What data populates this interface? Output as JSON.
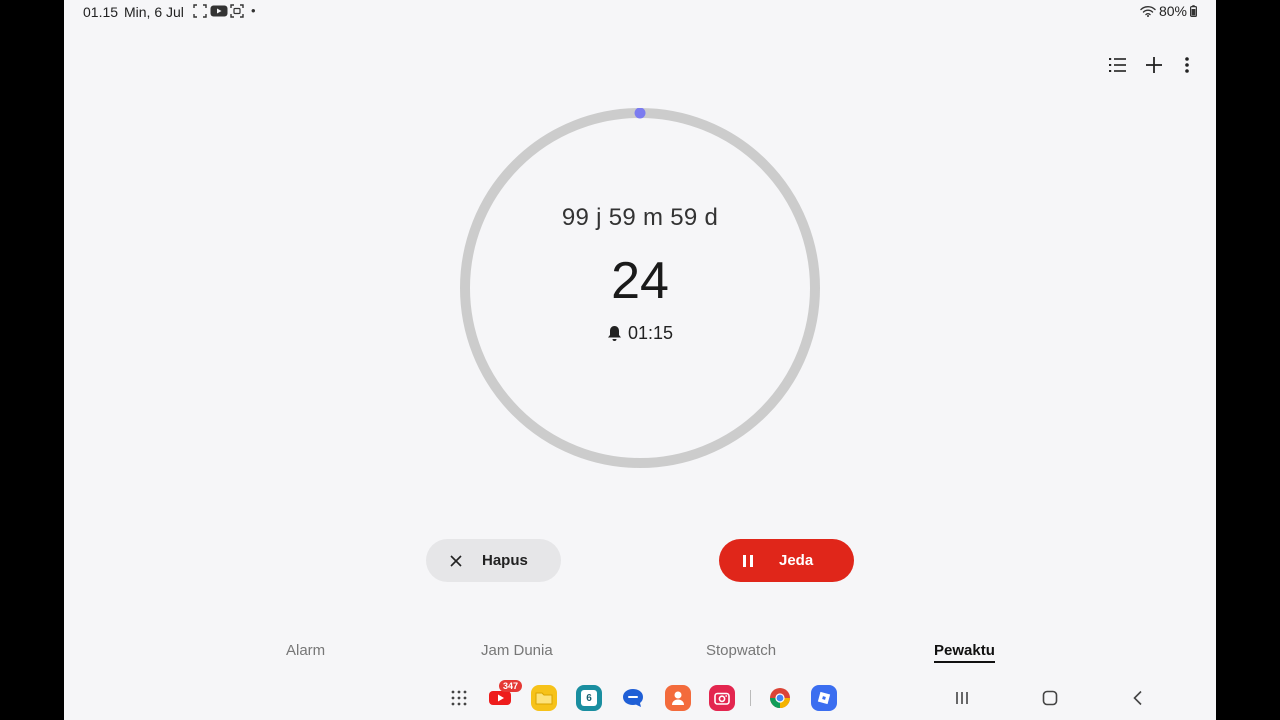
{
  "status_bar": {
    "time": "01.15",
    "date": "Min, 6 Jul",
    "dot": "•",
    "battery": "80%",
    "icons": [
      "screenshot-icon",
      "youtube-icon",
      "screen-record-icon",
      "wifi-icon",
      "battery-icon"
    ]
  },
  "toolbar": {
    "icons": [
      "list-icon",
      "plus-icon",
      "more-vert-icon"
    ]
  },
  "timer": {
    "remaining": "99 j 59 m 59 d",
    "preset": "24",
    "alarm_time": "01:15",
    "accent_color": "#7b7bf0",
    "ring_color": "#cccccc"
  },
  "actions": {
    "delete_label": "Hapus",
    "pause_label": "Jeda",
    "pause_color": "#e0261a"
  },
  "tabs": [
    {
      "label": "Alarm",
      "active": false
    },
    {
      "label": "Jam Dunia",
      "active": false
    },
    {
      "label": "Stopwatch",
      "active": false
    },
    {
      "label": "Pewaktu",
      "active": true
    }
  ],
  "dock": {
    "apps": [
      "apps-grid-icon",
      "youtube-icon",
      "files-icon",
      "calendar-icon",
      "messages-icon",
      "contacts-icon",
      "camera-icon",
      "chrome-icon",
      "roblox-icon"
    ],
    "youtube_badge": "347",
    "calendar_day": "6"
  },
  "nav": {
    "icons": [
      "recents-icon",
      "home-icon",
      "back-icon"
    ]
  }
}
